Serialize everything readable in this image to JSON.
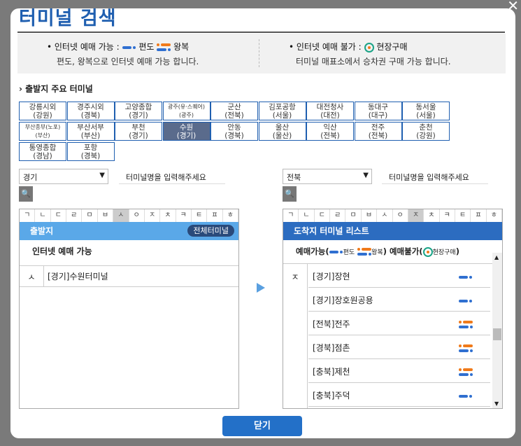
{
  "title": "터미널 검색",
  "close_glyph": "✕",
  "info": {
    "left": {
      "label": "• 인터넷 예매 가능 :",
      "oneway": "편도",
      "round": "왕복",
      "desc": "편도, 왕복으로 인터넷 예매 가능 합니다."
    },
    "right": {
      "label": "• 인터넷 예매 불가 :",
      "onsite": "현장구매",
      "desc": "터미널 매표소에서 승차권 구매 가능 합니다."
    }
  },
  "major_title": "› 출발지 주요 터미널",
  "terminals": [
    [
      "강릉시외",
      "(강원)"
    ],
    [
      "경주시외",
      "(경북)"
    ],
    [
      "고양종합",
      "(경기)"
    ],
    [
      "광주(유·스퀘어)",
      "(광주)"
    ],
    [
      "군산",
      "(전북)"
    ],
    [
      "김포공항",
      "(서울)"
    ],
    [
      "대전청사",
      "(대전)"
    ],
    [
      "동대구",
      "(대구)"
    ],
    [
      "동서울",
      "(서울)"
    ],
    [
      "부산종부(노포)",
      "(부산)"
    ],
    [
      "부산서부",
      "(부산)"
    ],
    [
      "부천",
      "(경기)"
    ],
    [
      "수원",
      "(경기)"
    ],
    [
      "안동",
      "(경북)"
    ],
    [
      "울산",
      "(울산)"
    ],
    [
      "익산",
      "(전북)"
    ],
    [
      "전주",
      "(전북)"
    ],
    [
      "춘천",
      "(강원)"
    ],
    [
      "통영종합",
      "(경남)"
    ],
    [
      "포항",
      "(경북)"
    ]
  ],
  "left": {
    "region": "경기",
    "placeholder": "터미널명을 입력해주세요",
    "search_glyph": "🔍",
    "alphabet": [
      "ㄱ",
      "ㄴ",
      "ㄷ",
      "ㄹ",
      "ㅁ",
      "ㅂ",
      "ㅅ",
      "ㅇ",
      "ㅈ",
      "ㅊ",
      "ㅋ",
      "ㅌ",
      "ㅍ",
      "ㅎ"
    ],
    "active_letter": "ㅅ",
    "header": "출발지",
    "all_button": "전체터미널",
    "subheader": "인터넷 예매 가능",
    "rows": [
      {
        "letter": "ㅅ",
        "name": "[경기]수원터미널"
      }
    ]
  },
  "right": {
    "region": "전북",
    "placeholder": "터미널명을 입력해주세요",
    "search_glyph": "🔍",
    "alphabet": [
      "ㄱ",
      "ㄴ",
      "ㄷ",
      "ㄹ",
      "ㅁ",
      "ㅂ",
      "ㅅ",
      "ㅇ",
      "ㅈ",
      "ㅊ",
      "ㅋ",
      "ㅌ",
      "ㅍ",
      "ㅎ"
    ],
    "active_letter": "ㅈ",
    "header": "도착지 터미널 리스트",
    "legend": {
      "prefix": "예매가능(",
      "oneway": "편도",
      "round": "왕복",
      "mid": ") 예매불가(",
      "onsite": "현장구매",
      "suffix": ")"
    },
    "letter": "ㅈ",
    "items": [
      {
        "name": "[경기]장현",
        "type": "oneway"
      },
      {
        "name": "[경기]장호원공용",
        "type": "oneway"
      },
      {
        "name": "[전북]전주",
        "type": "round"
      },
      {
        "name": "[경북]점촌",
        "type": "round"
      },
      {
        "name": "[충북]제천",
        "type": "round"
      },
      {
        "name": "[충북]주덕",
        "type": "oneway"
      }
    ]
  },
  "close_button": "닫기",
  "colors": {
    "accent": "#1f5fb0",
    "left_header": "#5aa8e8",
    "right_header": "#2c6cc0",
    "active_cell": "#5a6b8c"
  }
}
